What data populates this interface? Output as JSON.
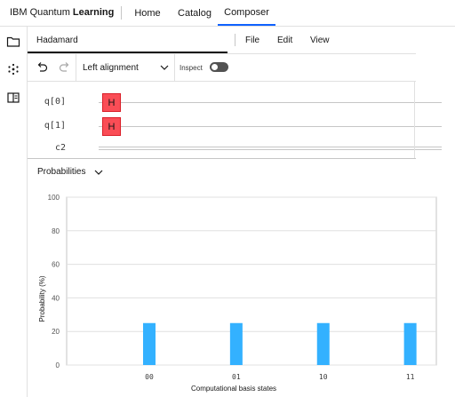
{
  "header": {
    "brand_plain": "IBM Quantum ",
    "brand_bold": "Learning",
    "nav": [
      {
        "label": "Home",
        "active": false
      },
      {
        "label": "Catalog",
        "active": false
      },
      {
        "label": "Composer",
        "active": true
      }
    ],
    "accent_color": "#0f62fe"
  },
  "sidebar": {
    "icons": [
      "folder-icon",
      "circuit-dots-icon",
      "panel-layout-icon"
    ]
  },
  "file": {
    "name": "Hadamard",
    "menu": [
      "File",
      "Edit",
      "View"
    ]
  },
  "toolbar": {
    "undo_icon": "undo-icon",
    "redo_icon": "redo-icon",
    "alignment": "Left alignment",
    "inspect_label": "Inspect",
    "inspect_on": false
  },
  "circuit": {
    "qubits": [
      {
        "label": "q[0]",
        "gate": "H"
      },
      {
        "label": "q[1]",
        "gate": "H"
      }
    ],
    "classical": "c2",
    "gate_color": "#fa4d56"
  },
  "probabilities": {
    "title": "Probabilities"
  },
  "chart_data": {
    "type": "bar",
    "categories": [
      "00",
      "01",
      "10",
      "11"
    ],
    "values": [
      25,
      25,
      25,
      25
    ],
    "xlabel": "Computational basis states",
    "ylabel": "Probability (%)",
    "ylim": [
      0,
      100
    ],
    "yticks": [
      0,
      20,
      40,
      60,
      80,
      100
    ],
    "grid": true,
    "bar_color": "#33b1ff"
  }
}
